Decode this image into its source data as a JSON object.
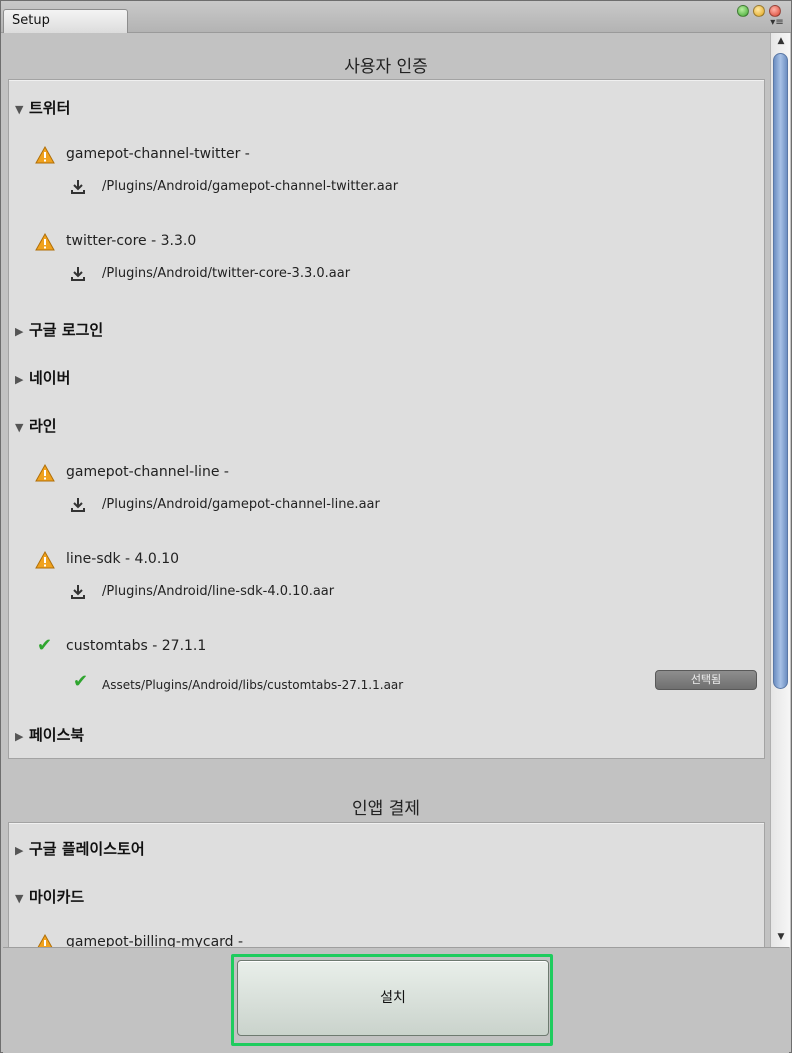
{
  "window": {
    "tab_title": "Setup"
  },
  "auth_section": {
    "title": "사용자 인증",
    "groups": [
      {
        "name": "트위터",
        "expanded": true,
        "packages": [
          {
            "status": "warning",
            "label": "gamepot-channel-twitter -",
            "path": "/Plugins/Android/gamepot-channel-twitter.aar"
          },
          {
            "status": "warning",
            "label": "twitter-core - 3.3.0",
            "path": "/Plugins/Android/twitter-core-3.3.0.aar"
          }
        ]
      },
      {
        "name": "구글 로그인",
        "expanded": false
      },
      {
        "name": "네이버",
        "expanded": false
      },
      {
        "name": "라인",
        "expanded": true,
        "packages": [
          {
            "status": "warning",
            "label": "gamepot-channel-line -",
            "path": "/Plugins/Android/gamepot-channel-line.aar"
          },
          {
            "status": "warning",
            "label": "line-sdk - 4.0.10",
            "path": "/Plugins/Android/line-sdk-4.0.10.aar"
          },
          {
            "status": "ok",
            "label": "customtabs - 27.1.1",
            "path": "Assets/Plugins/Android/libs/customtabs-27.1.1.aar",
            "button": "선택됨"
          }
        ]
      },
      {
        "name": "페이스북",
        "expanded": false
      }
    ]
  },
  "iap_section": {
    "title": "인앱 결제",
    "groups": [
      {
        "name": "구글 플레이스토어",
        "expanded": false
      },
      {
        "name": "마이카드",
        "expanded": true,
        "packages": [
          {
            "status": "warning",
            "label": "gamepot-billing-mycard -"
          }
        ]
      }
    ]
  },
  "footer": {
    "install_label": "설치"
  },
  "colors": {
    "highlight": "#1fcc5e",
    "check": "#2fa52f",
    "warning": "#f0a21e",
    "scroll_thumb": "#8aa8d6"
  }
}
